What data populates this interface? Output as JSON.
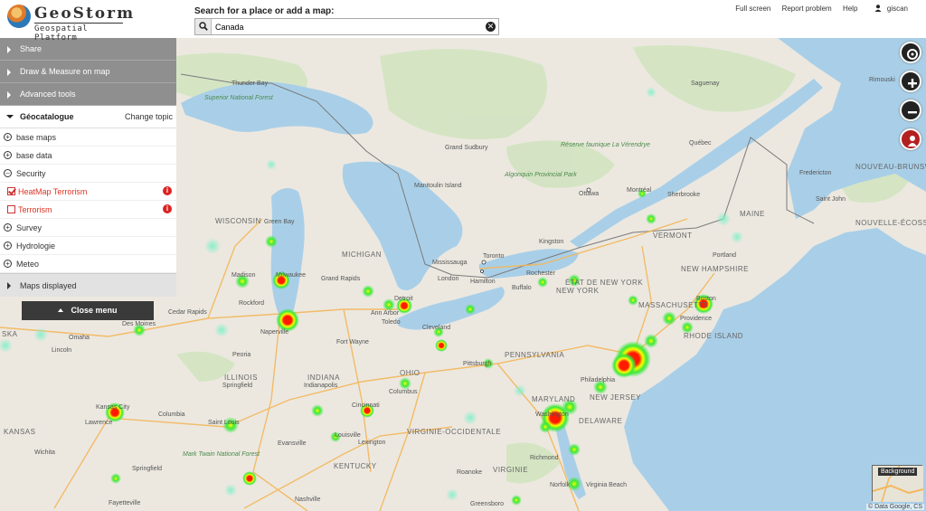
{
  "logo": {
    "title": "GeoStorm",
    "subtitle": "Geospatial Platform"
  },
  "search": {
    "label": "Search for a place or add a map:",
    "value": "Canada",
    "clear": "✕"
  },
  "toplinks": {
    "fullscreen": "Full screen",
    "report": "Report problem",
    "help": "Help",
    "user": "giscan"
  },
  "panel": {
    "accordion": [
      {
        "label": "Share"
      },
      {
        "label": "Draw & Measure on map"
      },
      {
        "label": "Advanced tools"
      }
    ],
    "geocatalogue": {
      "label": "Géocatalogue",
      "change_topic": "Change topic"
    },
    "tree": {
      "base_maps": "base maps",
      "base_data": "base data",
      "security": "Security",
      "heatmap": "HeatMap Terrorism",
      "terrorism": "Terrorism",
      "survey": "Survey",
      "hydrologie": "Hydrologie",
      "meteo": "Meteo"
    },
    "maps_displayed": "Maps displayed",
    "close_menu": "Close menu"
  },
  "map": {
    "background_label": "Background",
    "attribution": "© Data Google, CS",
    "labels": [
      "Superior National Forest",
      "Thunder Bay",
      "WISCONSIN",
      "Green Bay",
      "MICHIGAN",
      "Grand Rapids",
      "Madison",
      "Milwaukee",
      "Rockford",
      "Cedar Rapids",
      "Des Moines",
      "Naperville",
      "Omaha",
      "Lincoln",
      "Peoria",
      "ILLINOIS",
      "Springfield",
      "INDIANA",
      "Indianapolis",
      "Fort Wayne",
      "Ann Arbor",
      "Detroit",
      "Toledo",
      "Cleveland",
      "OHIO",
      "Columbus",
      "Cincinnati",
      "Pittsburgh",
      "PENNSYLVANIA",
      "Kansas City",
      "Lawrence",
      "Columbia",
      "KANSAS",
      "Wichita",
      "Saint Louis",
      "Mark Twain National Forest",
      "Springfield",
      "Evansville",
      "Louisville",
      "KENTUCKY",
      "Lexington",
      "Nashville",
      "Fayetteville",
      "VIRGINIE-OCCIDENTALE",
      "VIRGINIE",
      "Roanoke",
      "Greensboro",
      "Richmond",
      "Norfolk",
      "Virginia Beach",
      "MARYLAND",
      "Washington",
      "DELAWARE",
      "NEW JERSEY",
      "Philadelphia",
      "NEW YORK",
      "ÉTAT DE NEW YORK",
      "Rochester",
      "Buffalo",
      "Toronto",
      "Mississauga",
      "Hamilton",
      "London",
      "Kingston",
      "Ottawa",
      "Montréal",
      "Sherbrooke",
      "Québec",
      "Saguenay",
      "Grand Sudbury",
      "Algonquin Provincial Park",
      "Manitoulin Island",
      "Réserve faunique La Vérendrye",
      "VERMONT",
      "NEW HAMPSHIRE",
      "MASSACHUSETTS",
      "Boston",
      "Providence",
      "RHODE ISLAND",
      "MAINE",
      "Portland",
      "Fredericton",
      "NOUVEAU-BRUNSWICK",
      "Saint John",
      "NOUVELLE-ÉCOSSE",
      "Rimouski",
      "SKA"
    ]
  },
  "colors": {
    "panel_header": "#8f8f8f",
    "close_menu": "#3a3a3a",
    "heat_red": "#ff1a00",
    "heat_yellow": "#f7ff00",
    "heat_green": "#3ce83c",
    "water": "#a9cfe8",
    "land": "#ece8e0"
  }
}
